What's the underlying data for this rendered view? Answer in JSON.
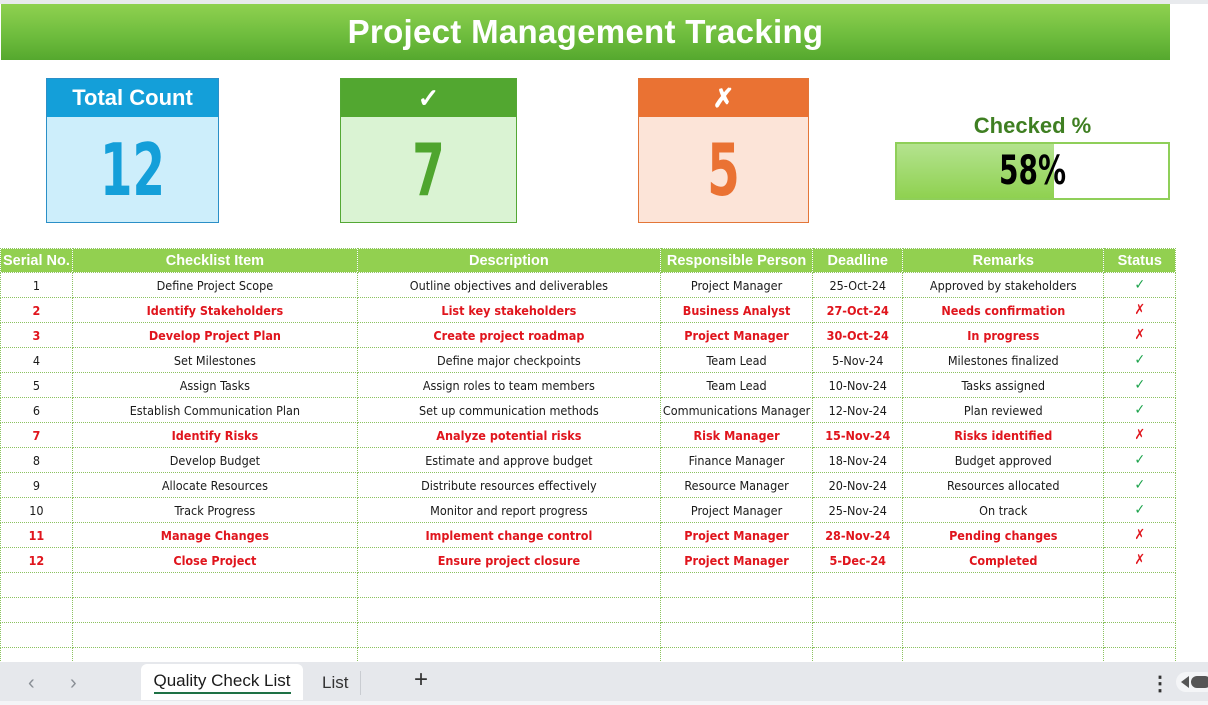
{
  "title": "Project Management Tracking",
  "cards": {
    "total": {
      "label": "Total Count",
      "value": "12"
    },
    "checked": {
      "label": "✓",
      "value": "7"
    },
    "unchecked": {
      "label": "✗",
      "value": "5"
    }
  },
  "checked_percent": {
    "label": "Checked %",
    "value_text": "58%",
    "fraction": 0.58
  },
  "table": {
    "headers": [
      "Serial No.",
      "Checklist Item",
      "Description",
      "Responsible Person",
      "Deadline",
      "Remarks",
      "Status"
    ],
    "rows": [
      {
        "serial": "1",
        "item": "Define Project Scope",
        "description": "Outline objectives and deliverables",
        "person": "Project Manager",
        "deadline": "25-Oct-24",
        "remarks": "Approved by stakeholders",
        "status": "✓",
        "done": true
      },
      {
        "serial": "2",
        "item": "Identify Stakeholders",
        "description": "List key stakeholders",
        "person": "Business Analyst",
        "deadline": "27-Oct-24",
        "remarks": "Needs confirmation",
        "status": "✗",
        "done": false
      },
      {
        "serial": "3",
        "item": "Develop Project Plan",
        "description": "Create project roadmap",
        "person": "Project Manager",
        "deadline": "30-Oct-24",
        "remarks": "In progress",
        "status": "✗",
        "done": false
      },
      {
        "serial": "4",
        "item": "Set Milestones",
        "description": "Define major checkpoints",
        "person": "Team Lead",
        "deadline": "5-Nov-24",
        "remarks": "Milestones finalized",
        "status": "✓",
        "done": true
      },
      {
        "serial": "5",
        "item": "Assign Tasks",
        "description": "Assign roles to team members",
        "person": "Team Lead",
        "deadline": "10-Nov-24",
        "remarks": "Tasks assigned",
        "status": "✓",
        "done": true
      },
      {
        "serial": "6",
        "item": "Establish Communication Plan",
        "description": "Set up communication methods",
        "person": "Communications Manager",
        "deadline": "12-Nov-24",
        "remarks": "Plan reviewed",
        "status": "✓",
        "done": true
      },
      {
        "serial": "7",
        "item": "Identify Risks",
        "description": "Analyze potential risks",
        "person": "Risk Manager",
        "deadline": "15-Nov-24",
        "remarks": "Risks identified",
        "status": "✗",
        "done": false
      },
      {
        "serial": "8",
        "item": "Develop Budget",
        "description": "Estimate and approve budget",
        "person": "Finance Manager",
        "deadline": "18-Nov-24",
        "remarks": "Budget approved",
        "status": "✓",
        "done": true
      },
      {
        "serial": "9",
        "item": "Allocate Resources",
        "description": "Distribute resources effectively",
        "person": "Resource Manager",
        "deadline": "20-Nov-24",
        "remarks": "Resources allocated",
        "status": "✓",
        "done": true
      },
      {
        "serial": "10",
        "item": "Track Progress",
        "description": "Monitor and report progress",
        "person": "Project Manager",
        "deadline": "25-Nov-24",
        "remarks": "On track",
        "status": "✓",
        "done": true
      },
      {
        "serial": "11",
        "item": "Manage Changes",
        "description": "Implement change control",
        "person": "Project Manager",
        "deadline": "28-Nov-24",
        "remarks": "Pending changes",
        "status": "✗",
        "done": false
      },
      {
        "serial": "12",
        "item": "Close Project",
        "description": "Ensure project closure",
        "person": "Project Manager",
        "deadline": "5-Dec-24",
        "remarks": "Completed",
        "status": "✗",
        "done": false
      }
    ],
    "empty_rows": 4
  },
  "sheet_tabs": {
    "prev_icon": "chevron-left-icon",
    "next_icon": "chevron-right-icon",
    "tabs": [
      {
        "label": "Quality Check List",
        "active": true
      },
      {
        "label": "List",
        "active": false
      }
    ],
    "add_label": "+",
    "more_label": "⋮"
  },
  "colors": {
    "banner": "#6cbb3c",
    "header": "#92d050",
    "total_accent": "#149fd9",
    "checked_accent": "#52a730",
    "unchecked_accent": "#ea7233",
    "bad_text": "#e0151d",
    "ok_mark": "#1aa24a"
  }
}
